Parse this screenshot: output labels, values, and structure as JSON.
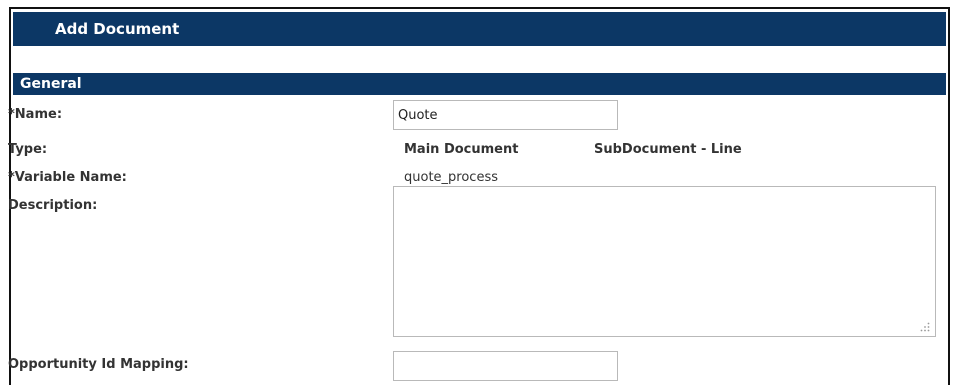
{
  "header": {
    "title": "Add Document"
  },
  "section": {
    "title": "General"
  },
  "fields": {
    "name": {
      "label": "*Name:",
      "value": "Quote"
    },
    "type": {
      "label": "Type:",
      "options": [
        "Main Document",
        "SubDocument - Line"
      ]
    },
    "variable_name": {
      "label": "*Variable Name:",
      "value": "quote_process"
    },
    "description": {
      "label": "Description:",
      "value": ""
    },
    "opportunity_id_mapping": {
      "label": "Opportunity Id Mapping:",
      "value": ""
    }
  },
  "colors": {
    "header_bg": "#0c3765",
    "header_text": "#ffffff",
    "input_border": "#b9b9b9"
  },
  "icons": {
    "textarea_resize": "resize-grip-icon"
  }
}
